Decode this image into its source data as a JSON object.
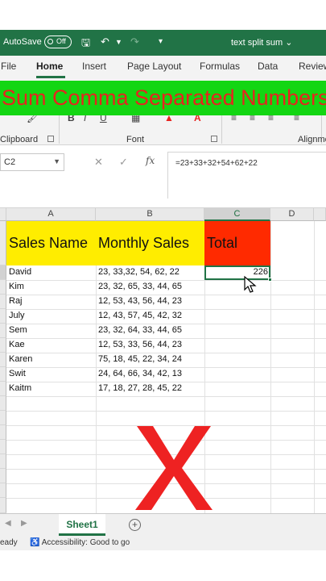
{
  "titlebar": {
    "autosave": "AutoSave",
    "toggle": "Off",
    "filename": "text split sum",
    "filename_arrow": "⌄"
  },
  "tabs": [
    "File",
    "Home",
    "Insert",
    "Page Layout",
    "Formulas",
    "Data",
    "Review"
  ],
  "active_tab": "Home",
  "banner": {
    "text": "Sum Comma Separated Numbers",
    "bg": "#13d613",
    "color": "#e8231f"
  },
  "ribbon": {
    "groups": [
      "Clipboard",
      "Font",
      "Alignme"
    ]
  },
  "formula_bar": {
    "name_box": "C2",
    "formula": "=23+33+32+54+62+22",
    "fx": "fx"
  },
  "columns": [
    "A",
    "B",
    "C",
    "D"
  ],
  "header_row": {
    "a": "Sales Name",
    "b": "Monthly Sales",
    "c": "Total",
    "a_bg": "#ffed00",
    "b_bg": "#ffed00",
    "c_bg": "#ff2a00"
  },
  "rows": [
    {
      "name": "David",
      "sales": "23, 33,32, 54, 62, 22"
    },
    {
      "name": "Kim",
      "sales": "23, 32, 65, 33, 44, 65"
    },
    {
      "name": "Raj",
      "sales": "12, 53, 43, 56, 44, 23"
    },
    {
      "name": "July",
      "sales": "12, 43, 57, 45, 42, 32"
    },
    {
      "name": "Sem",
      "sales": "23, 32, 64, 33, 44, 65"
    },
    {
      "name": "Kae",
      "sales": "12, 53, 33, 56, 44, 23"
    },
    {
      "name": "Karen",
      "sales": "75, 18, 45, 22, 34, 24"
    },
    {
      "name": "Swit",
      "sales": "24, 64, 66, 34, 42, 13"
    },
    {
      "name": "Kaitm",
      "sales": "17, 18, 27, 28, 45, 22"
    }
  ],
  "total_value": "226",
  "overlay": {
    "mark": "X",
    "color": "#ee2222"
  },
  "sheet_tab": "Sheet1",
  "status": {
    "ready": "eady",
    "accessibility": "Accessibility: Good to go"
  },
  "accent": "#217346"
}
